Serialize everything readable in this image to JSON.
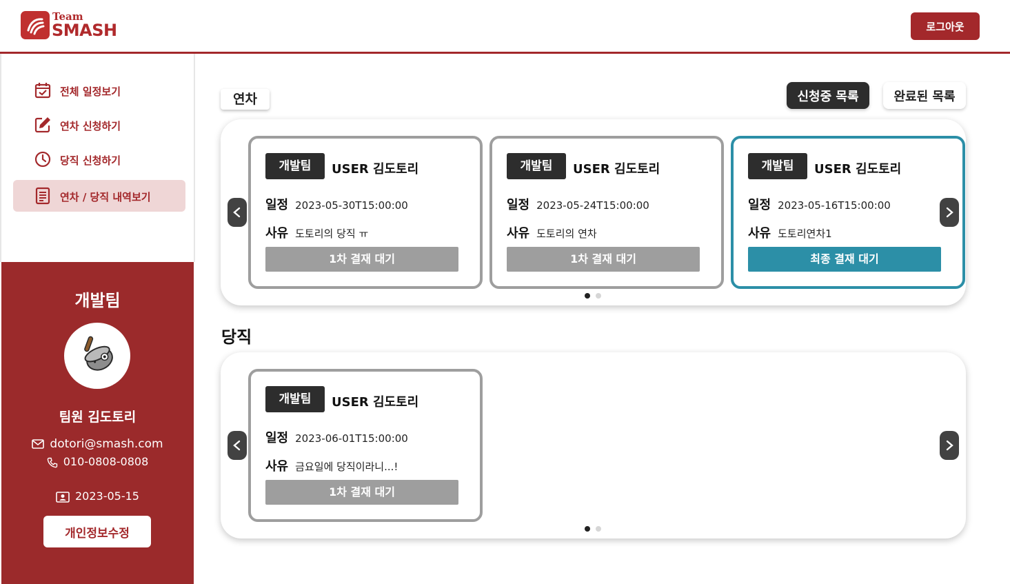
{
  "header": {
    "logo_team": "Team",
    "logo_smash": "SMASH",
    "logout_label": "로그아웃"
  },
  "sidebar": {
    "items": [
      {
        "label": "전체 일정보기",
        "icon": "calendar-check-icon"
      },
      {
        "label": "연차 신청하기",
        "icon": "edit-icon"
      },
      {
        "label": "당직 신청하기",
        "icon": "clock-icon"
      },
      {
        "label": "연차 / 당직 내역보기",
        "icon": "document-list-icon",
        "active": true
      }
    ]
  },
  "profile": {
    "team": "개발팀",
    "name": "팀원  김도토리",
    "email": "dotori@smash.com",
    "phone": "010-0808-0808",
    "join_date": "2023-05-15",
    "edit_label": "개인정보수정"
  },
  "main": {
    "leave_tab": "연차",
    "duty_heading": "당직",
    "toggle_pending": "신청중 목록",
    "toggle_done": "완료된 목록",
    "leave_cards": [
      {
        "team": "개발팀",
        "user": "USER  김도토리",
        "schedule_key": "일정",
        "schedule": "2023-05-30T15:00:00",
        "reason_key": "사유",
        "reason": "도토리의 당직 ㅠ",
        "status": "1차 결재 대기",
        "final": false
      },
      {
        "team": "개발팀",
        "user": "USER  김도토리",
        "schedule_key": "일정",
        "schedule": "2023-05-24T15:00:00",
        "reason_key": "사유",
        "reason": "도토리의 연차",
        "status": "1차 결재 대기",
        "final": false
      },
      {
        "team": "개발팀",
        "user": "USER  김도토리",
        "schedule_key": "일정",
        "schedule": "2023-05-16T15:00:00",
        "reason_key": "사유",
        "reason": "도토리연차1",
        "status": "최종 결재 대기",
        "final": true
      }
    ],
    "duty_cards": [
      {
        "team": "개발팀",
        "user": "USER  김도토리",
        "schedule_key": "일정",
        "schedule": "2023-06-01T15:00:00",
        "reason_key": "사유",
        "reason": "금요일에 당직이라니...!",
        "status": "1차 결재 대기",
        "final": false
      }
    ]
  },
  "colors": {
    "brand": "#a3282b",
    "profile_bg": "#9b2a2b",
    "active_menu_bg": "#efd6d6",
    "pending_status": "#9e9e9e",
    "final_status": "#2c8fa7",
    "dark": "#2d2d2d"
  }
}
